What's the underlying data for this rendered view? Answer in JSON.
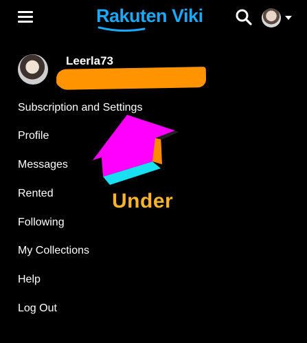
{
  "header": {
    "logo_text": "Rakuten Viki",
    "logo_color": "#1ea7f5",
    "icons": {
      "menu": "hamburger-icon",
      "search": "search-icon",
      "dropdown": "chevron-down-icon"
    }
  },
  "profile": {
    "username": "Leerla73",
    "redaction_color": "#ff9400"
  },
  "menu": {
    "items": [
      {
        "label": "Subscription and Settings"
      },
      {
        "label": "Profile"
      },
      {
        "label": "Messages"
      },
      {
        "label": "Rented"
      },
      {
        "label": "Following"
      },
      {
        "label": "My Collections"
      },
      {
        "label": "Help"
      },
      {
        "label": "Log Out"
      }
    ]
  },
  "annotation": {
    "text": "Under",
    "text_color": "#f6b431",
    "arrow_colors": {
      "face": "#ff00ff",
      "side": "#ff8a00",
      "base": "#18e0f0"
    }
  }
}
